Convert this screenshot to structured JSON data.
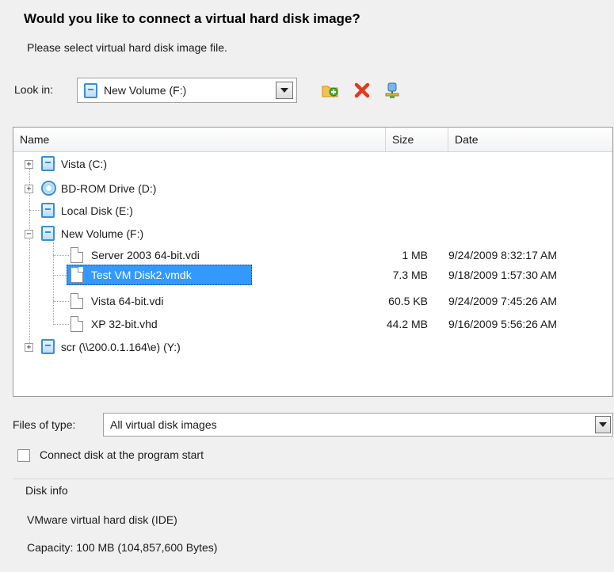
{
  "title": "Would you like to connect a virtual hard disk image?",
  "subtitle": "Please select virtual hard disk image file.",
  "look_in": {
    "label": "Look in:",
    "value": "New Volume (F:)"
  },
  "toolbar": {
    "new_folder_icon": "new-folder-icon",
    "delete_icon": "delete-icon",
    "network_icon": "network-drive-icon"
  },
  "columns": [
    "Name",
    "Size",
    "Date"
  ],
  "tree": [
    {
      "name": "Vista (C:)",
      "type": "drive",
      "expander": "+"
    },
    {
      "name": "BD-ROM Drive (D:)",
      "type": "cd",
      "expander": "+"
    },
    {
      "name": "Local Disk (E:)",
      "type": "drive",
      "expander": ""
    },
    {
      "name": "New Volume (F:)",
      "type": "drive",
      "expander": "−"
    },
    {
      "name": "Server 2003 64-bit.vdi",
      "type": "file",
      "size": "1 MB",
      "date": "9/24/2009 8:32:17 AM"
    },
    {
      "name": "Test VM Disk2.vmdk",
      "type": "file",
      "size": "7.3 MB",
      "date": "9/18/2009 1:57:30 AM",
      "selected": true
    },
    {
      "name": "Vista 64-bit.vdi",
      "type": "file",
      "size": "60.5 KB",
      "date": "9/24/2009 7:45:26 AM"
    },
    {
      "name": "XP 32-bit.vhd",
      "type": "file",
      "size": "44.2 MB",
      "date": "9/16/2009 5:56:26 AM"
    },
    {
      "name": "scr (\\\\200.0.1.164\\e) (Y:)",
      "type": "drive",
      "expander": "+"
    }
  ],
  "files_of_type": {
    "label": "Files of type:",
    "value": "All virtual disk images"
  },
  "connect_checkbox": {
    "label": "Connect disk at the program start",
    "checked": false
  },
  "disk_info": {
    "label": "Disk info",
    "type_text": "VMware virtual hard disk (IDE)",
    "capacity_text": "Capacity:  100 MB (104,857,600 Bytes)"
  },
  "colors": {
    "selection": "#3399ff",
    "drive_icon": "#3a8fd6",
    "delete_icon": "#e03a1e"
  }
}
